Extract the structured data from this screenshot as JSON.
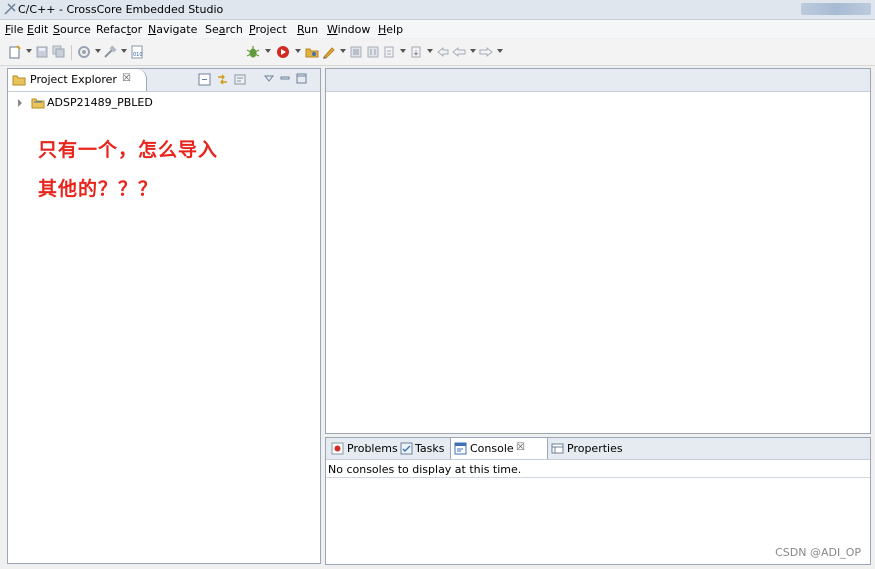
{
  "window": {
    "title": "C/C++ - CrossCore Embedded Studio"
  },
  "menu": {
    "items": [
      {
        "pre": "",
        "u": "F",
        "post": "ile"
      },
      {
        "pre": "",
        "u": "E",
        "post": "dit"
      },
      {
        "pre": "",
        "u": "S",
        "post": "ource"
      },
      {
        "pre": "Refac",
        "u": "t",
        "post": "or"
      },
      {
        "pre": "",
        "u": "N",
        "post": "avigate"
      },
      {
        "pre": "Se",
        "u": "a",
        "post": "rch"
      },
      {
        "pre": "",
        "u": "P",
        "post": "roject"
      },
      {
        "pre": "",
        "u": "R",
        "post": "un"
      },
      {
        "pre": "",
        "u": "W",
        "post": "indow"
      },
      {
        "pre": "",
        "u": "H",
        "post": "elp"
      }
    ]
  },
  "project_explorer": {
    "tab_label": "Project Explorer",
    "close_glyph": "☒",
    "tree": [
      {
        "label": "ADSP21489_PBLED"
      }
    ]
  },
  "annotation": {
    "line1": "只有一个，怎么导入",
    "line2": "其他的？？？",
    "color": "#e8241c"
  },
  "bottom_panel": {
    "tabs": [
      {
        "label": "Problems"
      },
      {
        "label": "Tasks"
      },
      {
        "label": "Console",
        "active": true,
        "close_glyph": "☒"
      },
      {
        "label": "Properties"
      }
    ],
    "console_message": "No consoles to display at this time."
  },
  "watermark": "CSDN @ADI_OP"
}
